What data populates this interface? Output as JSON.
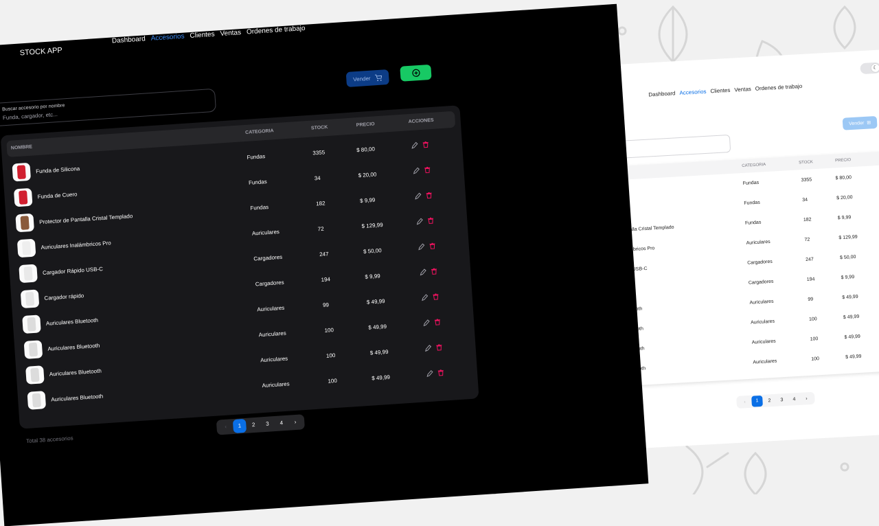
{
  "app": {
    "brand": "STOCK APP"
  },
  "nav": {
    "items": [
      "Dashboard",
      "Accesorios",
      "Clientes",
      "Ventas",
      "Ordenes de trabajo"
    ],
    "active": "Accesorios"
  },
  "actions": {
    "sell_label": "Vender",
    "cart_icon": "cart-icon",
    "add_icon": "plus-circle-icon"
  },
  "search": {
    "label": "Buscar accesorio por nombre",
    "placeholder": "Funda, cargador, etc..."
  },
  "table": {
    "headers": {
      "name": "NOMBRE",
      "category": "CATEGORIA",
      "stock": "STOCK",
      "price": "PRECIO",
      "actions": "ACCIONES"
    },
    "rows": [
      {
        "name": "Funda de Silicona",
        "category": "Fundas",
        "stock": "3355",
        "price": "$ 80,00"
      },
      {
        "name": "Funda de Cuero",
        "category": "Fundas",
        "stock": "34",
        "price": "$ 20,00"
      },
      {
        "name": "Protector de Pantalla Cristal Templado",
        "category": "Fundas",
        "stock": "182",
        "price": "$ 9,99"
      },
      {
        "name": "Auriculares Inalámbricos Pro",
        "category": "Auriculares",
        "stock": "72",
        "price": "$ 129,99"
      },
      {
        "name": "Cargador Rápido USB-C",
        "category": "Cargadores",
        "stock": "247",
        "price": "$ 50,00"
      },
      {
        "name": "Cargador rápido",
        "category": "Cargadores",
        "stock": "194",
        "price": "$ 9,99"
      },
      {
        "name": "Auriculares Bluetooth",
        "category": "Auriculares",
        "stock": "99",
        "price": "$ 49,99"
      },
      {
        "name": "Auriculares Bluetooth",
        "category": "Auriculares",
        "stock": "100",
        "price": "$ 49,99"
      },
      {
        "name": "Auriculares Bluetooth",
        "category": "Auriculares",
        "stock": "100",
        "price": "$ 49,99"
      },
      {
        "name": "Auriculares Bluetooth",
        "category": "Auriculares",
        "stock": "100",
        "price": "$ 49,99"
      }
    ],
    "edit_icon": "pencil-icon",
    "delete_icon": "trash-icon"
  },
  "footer": {
    "total": "Total 38 accesorios"
  },
  "pagination": {
    "pages": [
      "1",
      "2",
      "3",
      "4"
    ],
    "current": "1",
    "prev": "‹",
    "next": "›"
  },
  "theme": {
    "accent": "#0a6fe6",
    "success": "#17c964",
    "danger": "#f31260",
    "dark_bg": "#000000",
    "light_bg": "#ffffff"
  }
}
